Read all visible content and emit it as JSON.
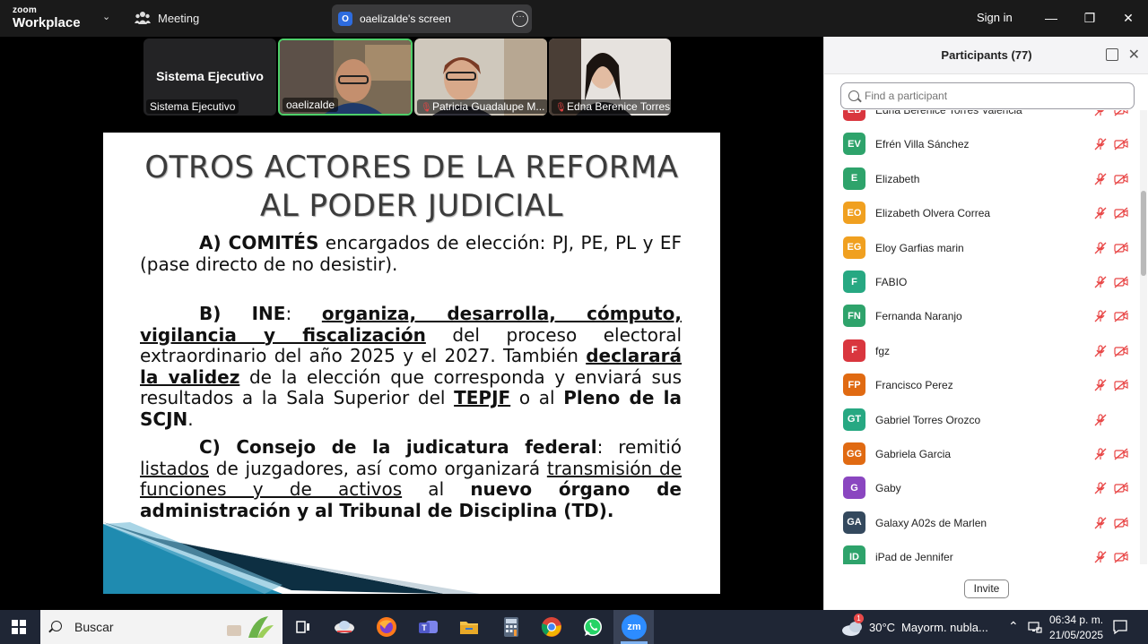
{
  "app": {
    "logo_line1": "zoom",
    "logo_line2": "Workplace",
    "meeting_label": "Meeting",
    "screen_share_label": "oaelizalde's screen",
    "screen_share_badge": "O",
    "signin_label": "Sign in",
    "more_label": "···",
    "window_controls": {
      "minimize": "—",
      "maximize": "❐",
      "close": "✕"
    }
  },
  "video_tiles": [
    {
      "name": "Sistema Ejecutivo",
      "center_label": "Sistema Ejecutivo",
      "muted": false
    },
    {
      "name": "oaelizalde",
      "muted": false,
      "active": true
    },
    {
      "name": "Patricia Guadalupe M...",
      "muted": true
    },
    {
      "name": "Edna Berenice Torres...",
      "muted": true
    }
  ],
  "slide": {
    "title_line1": "OTROS ACTORES DE LA REFORMA",
    "title_line2": "AL PODER JUDICIAL",
    "a_label": "A) COMITÉS",
    "a_text": " encargados de elección: PJ, PE, PL y EF (pase directo de no desistir).",
    "b_label": "B) INE",
    "b_colon": ": ",
    "b_u1": "organiza, desarrolla, cómputo, vigilancia y fiscalización",
    "b_t1": " del proceso electoral extraordinario del año 2025 y el 2027. También ",
    "b_u2": "declarará la validez",
    "b_t2": " de la elección que corresponda y enviará sus resultados a la Sala Superior del ",
    "b_u3": "TEPJF",
    "b_t3": " o al ",
    "b_b4": "Pleno de la SCJN",
    "b_t4": ".",
    "c_label": "C) Consejo de la judicatura federal",
    "c_t1": ": remitió ",
    "c_u1": "listados",
    "c_t2": " de juzgadores, así como organizará ",
    "c_u2": "transmisión de funciones y de activos",
    "c_t3": " al ",
    "c_b3": "nuevo órgano de administración y al Tribunal de Disciplina (TD)."
  },
  "participants": {
    "title": "Participants (77)",
    "search_placeholder": "Find a participant",
    "invite_label": "Invite",
    "items": [
      {
        "initials": "EB",
        "name": "Edna Berenice Torres Valencia",
        "color": "#d9363e",
        "cam": true
      },
      {
        "initials": "EV",
        "name": "Efrén Villa Sánchez",
        "color": "#2ea36b",
        "cam": true
      },
      {
        "initials": "E",
        "name": "Elizabeth",
        "color": "#2ea36b",
        "cam": true
      },
      {
        "initials": "EO",
        "name": "Elizabeth Olvera Correa",
        "color": "#f0a020",
        "cam": true
      },
      {
        "initials": "EG",
        "name": "Eloy Garfias marin",
        "color": "#f0a020",
        "cam": true
      },
      {
        "initials": "F",
        "name": "FABIO",
        "color": "#27a882",
        "cam": true
      },
      {
        "initials": "FN",
        "name": "Fernanda Naranjo",
        "color": "#2ea36b",
        "cam": true
      },
      {
        "initials": "F",
        "name": "fgz",
        "color": "#d9363e",
        "cam": true
      },
      {
        "initials": "FP",
        "name": "Francisco Perez",
        "color": "#e06a12",
        "cam": true
      },
      {
        "initials": "GT",
        "name": "Gabriel Torres Orozco",
        "color": "#27a882",
        "cam": false
      },
      {
        "initials": "GG",
        "name": "Gabriela Garcia",
        "color": "#e06a12",
        "cam": true
      },
      {
        "initials": "G",
        "name": "Gaby",
        "color": "#8a46c0",
        "cam": true
      },
      {
        "initials": "GA",
        "name": "Galaxy A02s de Marlen",
        "color": "#34495e",
        "cam": true
      },
      {
        "initials": "ID",
        "name": "iPad de Jennifer",
        "color": "#2ea36b",
        "cam": true
      }
    ]
  },
  "taskbar": {
    "search_label": "Buscar",
    "weather_temp": "30°C",
    "weather_text": "Mayorm. nubla...",
    "weather_badge": "1",
    "time": "06:34 p. m.",
    "date": "21/05/2025",
    "zoom_app_label": "zm"
  },
  "colors": {
    "mic_off": "#e84444",
    "active_tile_border": "#4ed06a",
    "slide_accent": "#1f8bb0"
  }
}
